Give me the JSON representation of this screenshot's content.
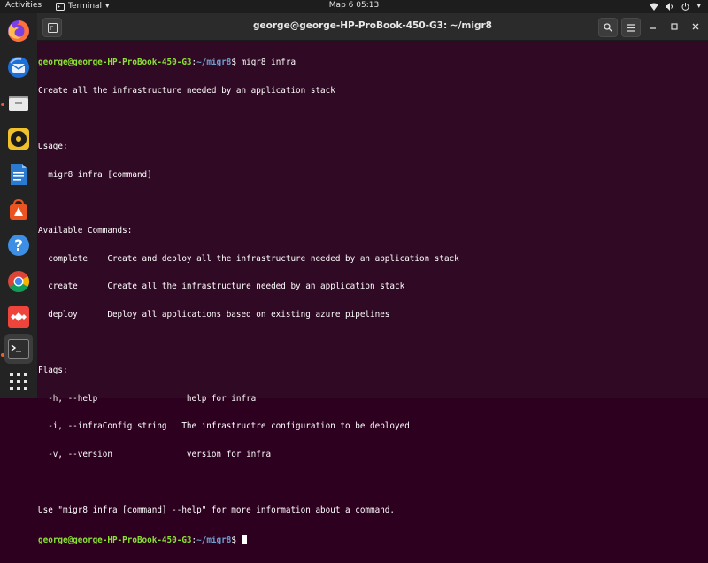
{
  "topbar": {
    "activities": "Activities",
    "app_name": "Terminal",
    "clock": "Мар 6  05:13"
  },
  "dock": {
    "items": [
      {
        "name": "Firefox",
        "icon": "firefox-icon"
      },
      {
        "name": "Thunderbird",
        "icon": "thunderbird-icon"
      },
      {
        "name": "Files",
        "icon": "files-icon"
      },
      {
        "name": "Rhythmbox",
        "icon": "rhythmbox-icon"
      },
      {
        "name": "LibreOffice Writer",
        "icon": "writer-icon"
      },
      {
        "name": "Ubuntu Software",
        "icon": "software-icon"
      },
      {
        "name": "Help",
        "icon": "help-icon"
      },
      {
        "name": "Google Chrome",
        "icon": "chrome-icon"
      },
      {
        "name": "AnyDesk",
        "icon": "anydesk-icon"
      },
      {
        "name": "Terminal",
        "icon": "terminal-icon"
      },
      {
        "name": "Show Applications",
        "icon": "apps-grid-icon"
      }
    ]
  },
  "window": {
    "title": "george@george-HP-ProBook-450-G3: ~/migr8"
  },
  "terminal": {
    "user": "george@george-HP-ProBook-450-G3",
    "colon": ":",
    "path": "~/migr8",
    "prompt_char": "$ ",
    "command": "migr8 infra",
    "output": [
      "Create all the infrastructure needed by an application stack",
      "",
      "Usage:",
      "  migr8 infra [command]",
      "",
      "Available Commands:",
      "  complete    Create and deploy all the infrastructure needed by an application stack",
      "  create      Create all the infrastructure needed by an application stack",
      "  deploy      Deploy all applications based on existing azure pipelines",
      "",
      "Flags:",
      "  -h, --help                  help for infra",
      "  -i, --infraConfig string   The infrastructre configuration to be deployed",
      "  -v, --version               version for infra",
      "",
      "Use \"migr8 infra [command] --help\" for more information about a command."
    ]
  },
  "colors": {
    "terminal_bg": "#300a24",
    "user_green": "#8ae234",
    "path_blue": "#729fcf",
    "topbar_bg": "#1d1d1d",
    "dock_bg": "#232323"
  }
}
